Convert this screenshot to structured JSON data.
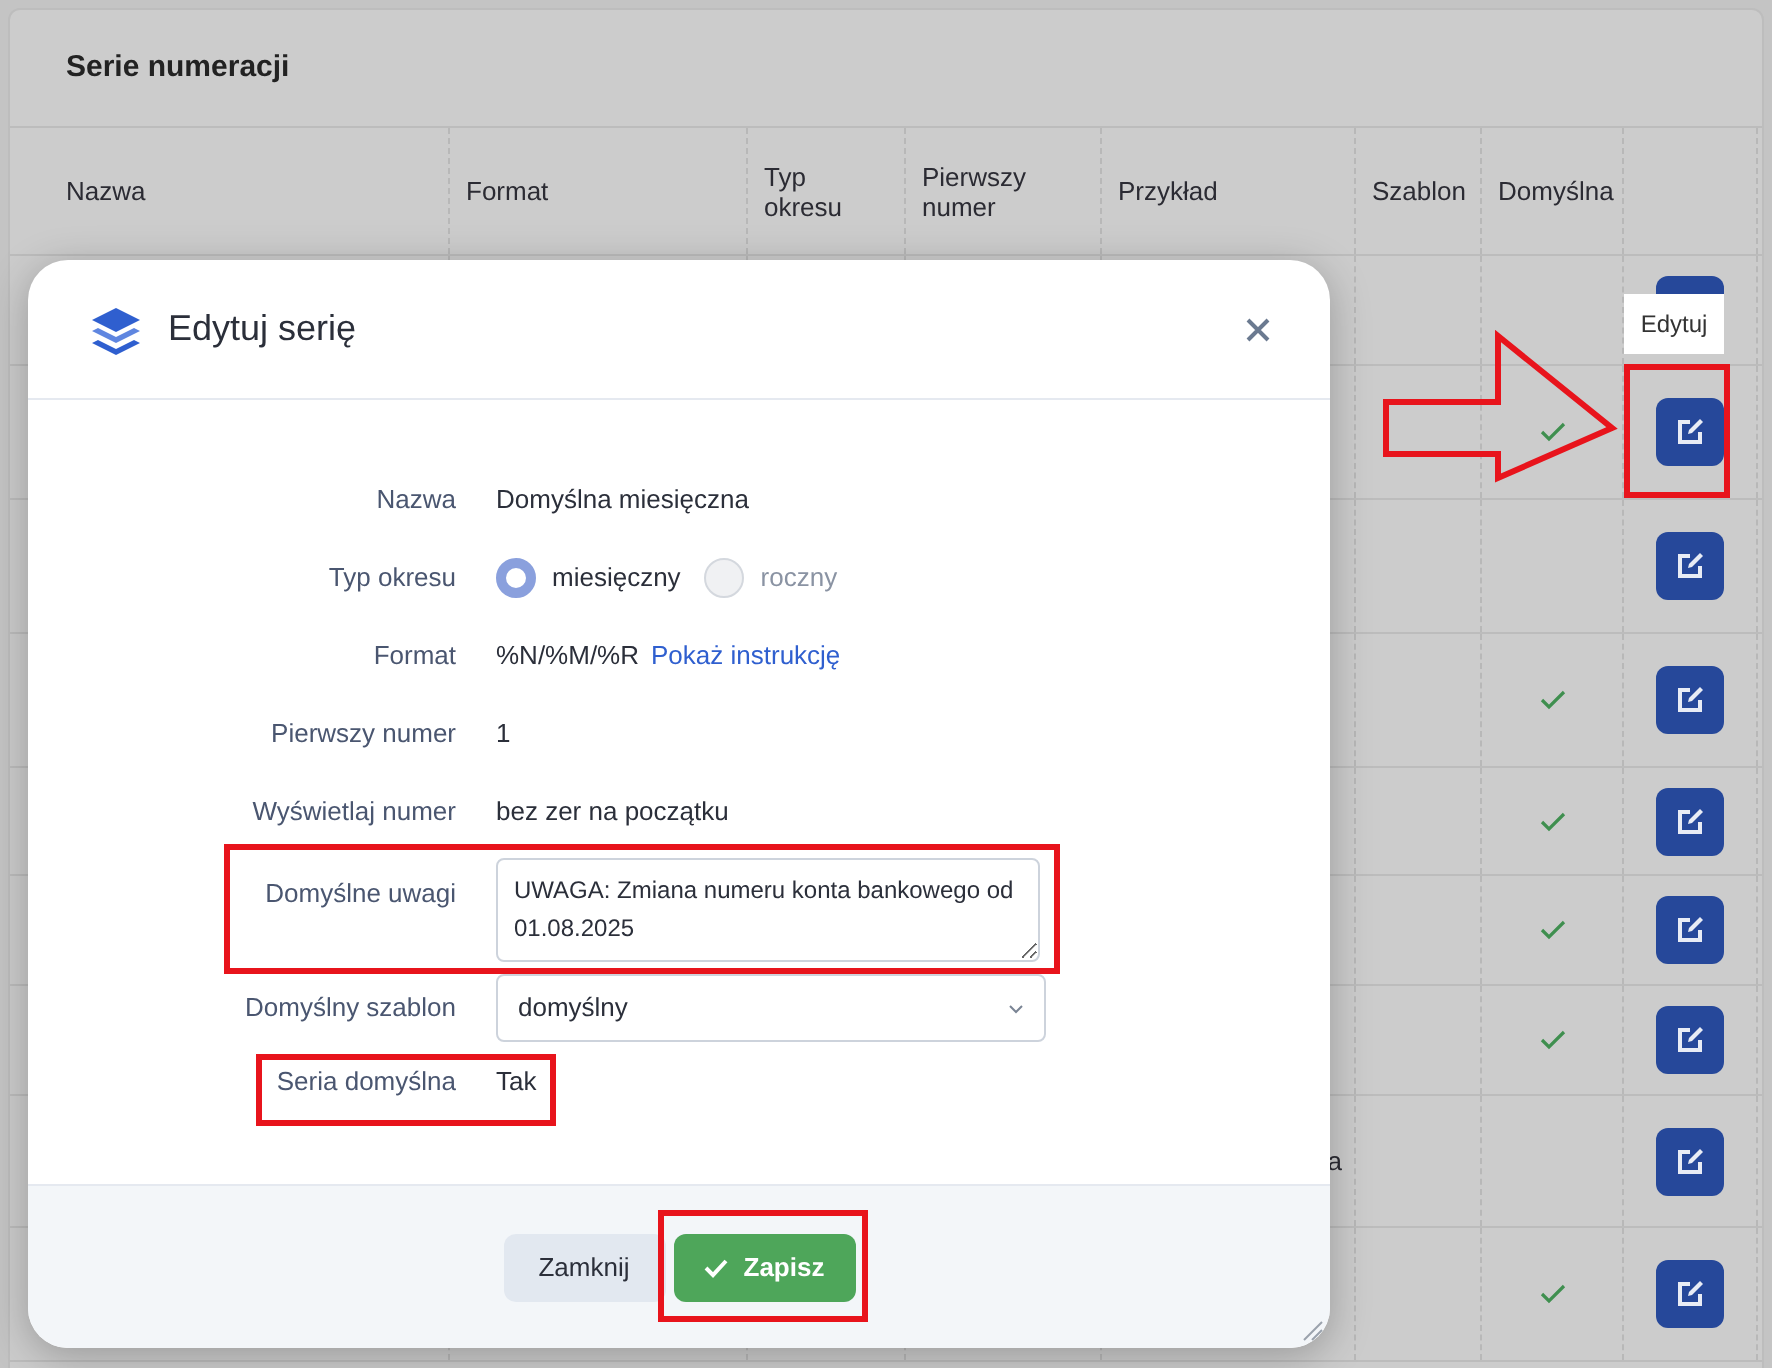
{
  "page": {
    "title": "Serie numeracji"
  },
  "table": {
    "columns": [
      "Nazwa",
      "Format",
      "Typ okresu",
      "Pierwszy numer",
      "Przykład",
      "Szablon",
      "Domyślna"
    ],
    "rows": [
      {
        "default": false
      },
      {
        "default": true
      },
      {
        "default": false
      },
      {
        "default": true
      },
      {
        "default": true
      },
      {
        "default": true
      },
      {
        "default": true
      },
      {
        "default": false,
        "example": "a"
      },
      {
        "default": true
      }
    ]
  },
  "tooltip": {
    "text": "Edytuj"
  },
  "modal": {
    "title": "Edytuj serię",
    "fields": [
      {
        "kind": "text",
        "label": "Nazwa",
        "value": "Domyślna miesięczna"
      },
      {
        "kind": "radio",
        "label": "Typ okresu",
        "options": [
          {
            "label": "miesięczny",
            "selected": true
          },
          {
            "label": "roczny",
            "selected": false
          }
        ]
      },
      {
        "kind": "format",
        "label": "Format",
        "value": "%N/%M/%R",
        "link": "Pokaż instrukcję"
      },
      {
        "kind": "text",
        "label": "Pierwszy numer",
        "value": "1"
      },
      {
        "kind": "text",
        "label": "Wyświetlaj numer",
        "value": "bez zer na początku"
      },
      {
        "kind": "textarea",
        "label": "Domyślne uwagi",
        "value": "UWAGA: Zmiana numeru konta bankowego od 01.08.2025"
      },
      {
        "kind": "select",
        "label": "Domyślny szablon",
        "value": "domyślny"
      },
      {
        "kind": "text",
        "label": "Seria domyślna",
        "value": "Tak"
      }
    ],
    "buttons": [
      {
        "kind": "secondary",
        "label": "Zamknij"
      },
      {
        "kind": "primary",
        "label": "Zapisz"
      }
    ]
  }
}
